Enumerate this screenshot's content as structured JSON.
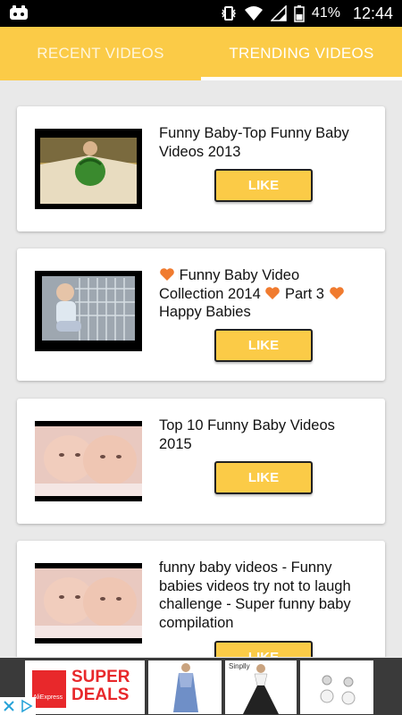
{
  "status": {
    "battery": "41%",
    "time": "12:44"
  },
  "tabs": [
    {
      "label": "RECENT VIDEOS"
    },
    {
      "label": "TRENDING VIDEOS"
    }
  ],
  "videos": [
    {
      "title": "Funny Baby-Top Funny Baby Videos 2013",
      "like_label": "LIKE"
    },
    {
      "title_parts": [
        "Funny Baby Video Collection 2014",
        "Part 3",
        "Happy Babies"
      ],
      "like_label": "LIKE"
    },
    {
      "title": "Top 10 Funny Baby Videos 2015",
      "like_label": "LIKE"
    },
    {
      "title": "funny baby videos - Funny babies videos try not to laugh challenge - Super funny baby compilation",
      "like_label": "LIKE"
    }
  ],
  "ad": {
    "super": "SUPER",
    "deals": "DEALS",
    "brand": "AliExpress",
    "store": "Sinplly"
  },
  "colors": {
    "accent": "#fbcb47",
    "heart": "#f07b2f",
    "ad_red": "#e8282b"
  }
}
